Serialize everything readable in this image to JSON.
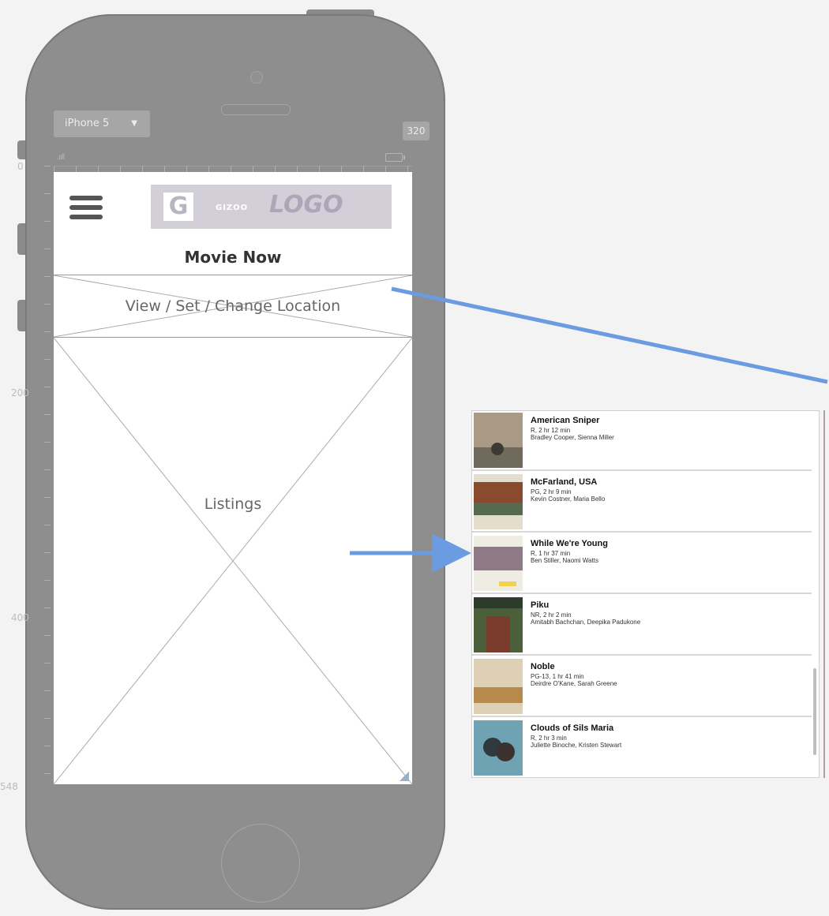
{
  "device": {
    "model_label": "iPhone 5",
    "width_label": "320"
  },
  "rulers": {
    "labels": [
      "0",
      "200",
      "400",
      "548"
    ]
  },
  "app": {
    "logo_brand": "GIZOO",
    "logo_text": "LOGO",
    "page_title": "Movie Now",
    "location_label": "View / Set / Change Location",
    "listings_label": "Listings"
  },
  "listings": [
    {
      "title": "American Sniper",
      "meta": "R, 2 hr 12 min",
      "cast": "Bradley Cooper, Sienna Miller"
    },
    {
      "title": "McFarland, USA",
      "meta": "PG, 2 hr 9 min",
      "cast": "Kevin Costner, Maria Bello"
    },
    {
      "title": "While We're Young",
      "meta": "R, 1 hr 37 min",
      "cast": "Ben Stiller, Naomi Watts"
    },
    {
      "title": "Piku",
      "meta": "NR, 2 hr 2 min",
      "cast": "Amitabh Bachchan, Deepika Padukone"
    },
    {
      "title": "Noble",
      "meta": "PG-13, 1 hr 41 min",
      "cast": "Deirdre O'Kane, Sarah Greene"
    },
    {
      "title": "Clouds of Sils Maria",
      "meta": "R, 2 hr 3 min",
      "cast": "Juliette Binoche, Kristen Stewart"
    }
  ],
  "colors": {
    "phone_body": "#8e8e8e",
    "arrow": "#6b9be0",
    "logo_bg": "#d2cfd8"
  }
}
